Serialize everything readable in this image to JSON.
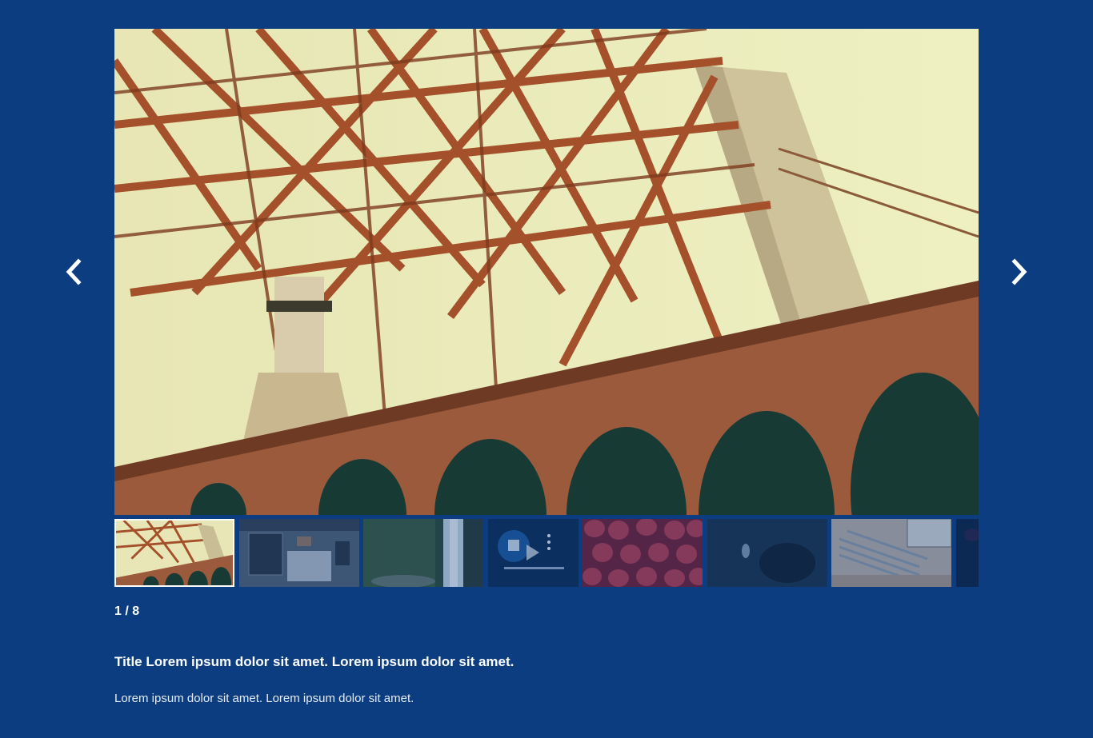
{
  "gallery": {
    "counter": "1 / 8",
    "caption": {
      "title": "Title Lorem ipsum dolor sit amet. Lorem ipsum dolor sit amet.",
      "description": "Lorem ipsum dolor sit amet. Lorem ipsum dolor sit amet."
    },
    "navigation": {
      "prev_icon": "chevron-left-icon",
      "next_icon": "chevron-right-icon"
    },
    "main_image": "bridge-arches-photo",
    "thumbnails": [
      {
        "subject": "bridge",
        "active": true
      },
      {
        "subject": "desk-laptop"
      },
      {
        "subject": "waterfall"
      },
      {
        "subject": "video",
        "video_icon": "play-icon"
      },
      {
        "subject": "strawberries"
      },
      {
        "subject": "diver"
      },
      {
        "subject": "pens"
      },
      {
        "subject": "dark"
      }
    ],
    "colors": {
      "background": "#0b3d80",
      "text": "#ffffff",
      "active_border": "#ffffff"
    }
  }
}
